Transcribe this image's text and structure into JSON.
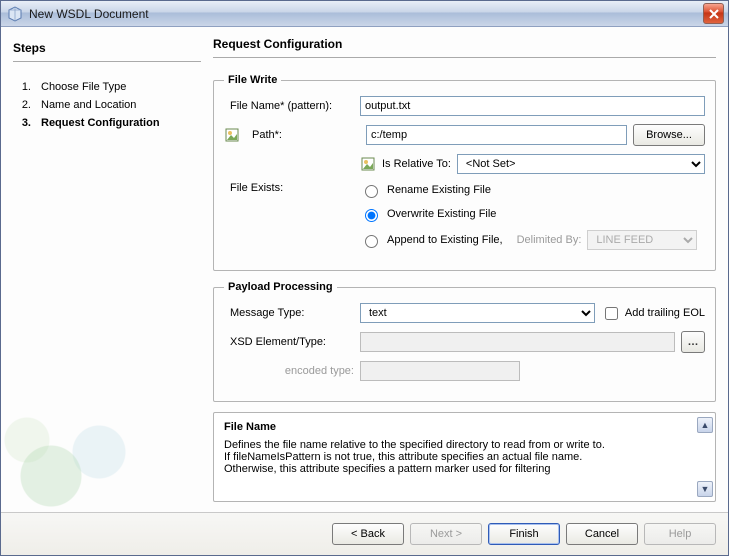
{
  "window": {
    "title": "New WSDL Document"
  },
  "steps": {
    "header": "Steps",
    "items": [
      {
        "num": "1.",
        "label": "Choose File Type"
      },
      {
        "num": "2.",
        "label": "Name and Location"
      },
      {
        "num": "3.",
        "label": "Request Configuration",
        "current": true
      }
    ]
  },
  "main": {
    "header": "Request Configuration",
    "fileWrite": {
      "legend": "File Write",
      "fileNameLabel": "File Name* (pattern):",
      "fileNameValue": "output.txt",
      "pathLabel": "Path*:",
      "pathValue": "c:/temp",
      "browse": "Browse...",
      "isRelativeLabel": "Is Relative To:",
      "isRelativeValue": "<Not Set>",
      "fileExistsLabel": "File Exists:",
      "radios": {
        "rename": "Rename Existing File",
        "overwrite": "Overwrite Existing File",
        "append": "Append to Existing File,",
        "delimLabel": "Delimited By:",
        "delimValue": "LINE FEED",
        "selected": "overwrite"
      }
    },
    "payload": {
      "legend": "Payload Processing",
      "messageTypeLabel": "Message Type:",
      "messageTypeValue": "text",
      "addTrailing": "Add trailing EOL",
      "xsdLabel": "XSD Element/Type:",
      "xsdValue": "",
      "encodedLabel": "encoded type:",
      "encodedValue": ""
    },
    "desc": {
      "title": "File Name",
      "line1": "Defines the file name relative to the specified directory to read from or write to.",
      "line2": "If fileNameIsPattern is not true, this attribute specifies an actual file name.",
      "line3": "Otherwise, this attribute specifies a pattern marker used for filtering"
    }
  },
  "buttons": {
    "back": "< Back",
    "next": "Next >",
    "finish": "Finish",
    "cancel": "Cancel",
    "help": "Help"
  }
}
